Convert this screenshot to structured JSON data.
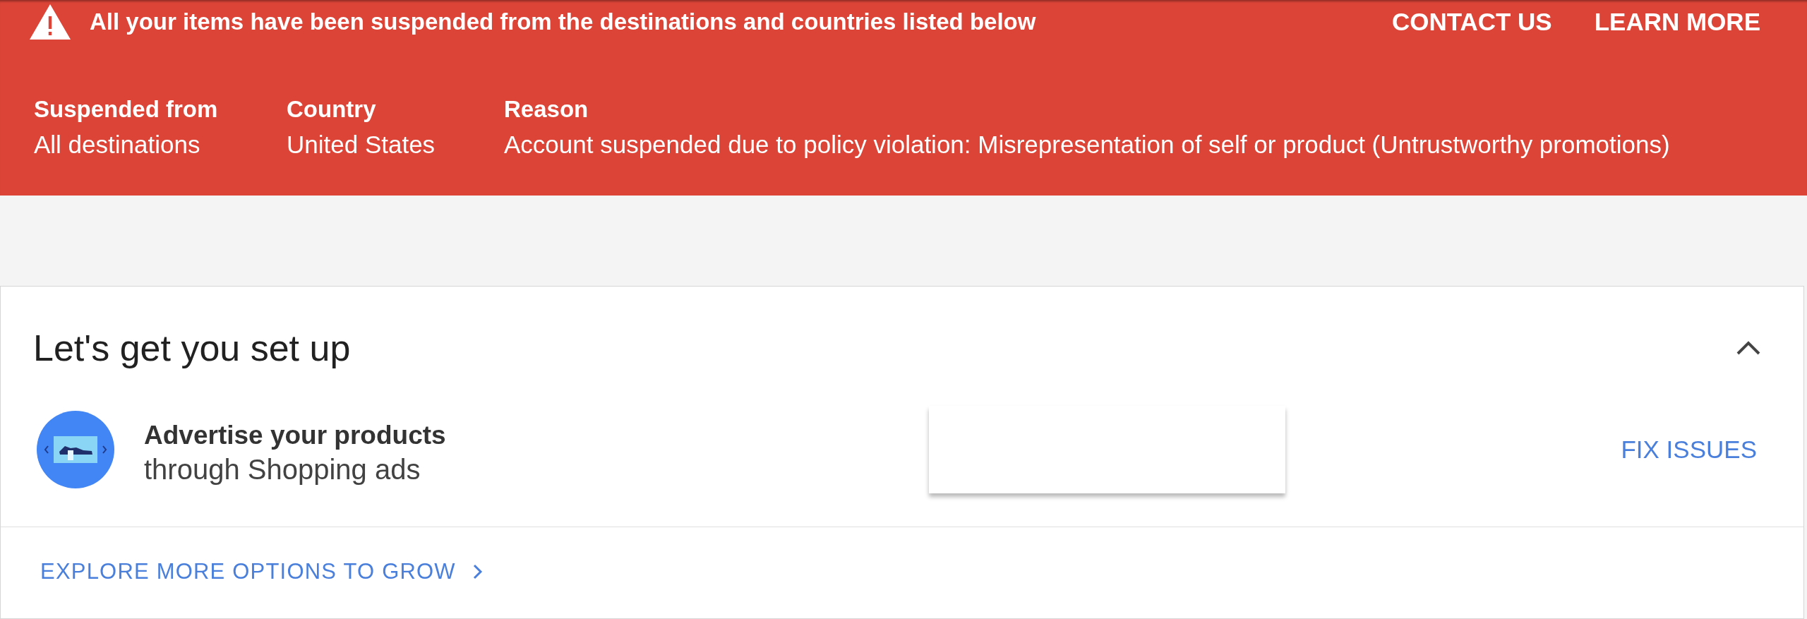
{
  "banner": {
    "message": "All your items have been suspended from the destinations and countries listed below",
    "actions": [
      "CONTACT US",
      "LEARN MORE"
    ],
    "columns": [
      {
        "heading": "Suspended from",
        "value": "All destinations"
      },
      {
        "heading": "Country",
        "value": "United States"
      },
      {
        "heading": "Reason",
        "value": "Account suspended due to policy violation: Misrepresentation of self or product (Untrustworthy promotions)"
      }
    ]
  },
  "setup_card": {
    "title": "Let's get you set up",
    "expanded": true,
    "tasks": [
      {
        "title": "Advertise your products",
        "subtitle": "through Shopping ads",
        "action": "FIX ISSUES"
      }
    ],
    "footer_link": "EXPLORE MORE OPTIONS TO GROW"
  }
}
